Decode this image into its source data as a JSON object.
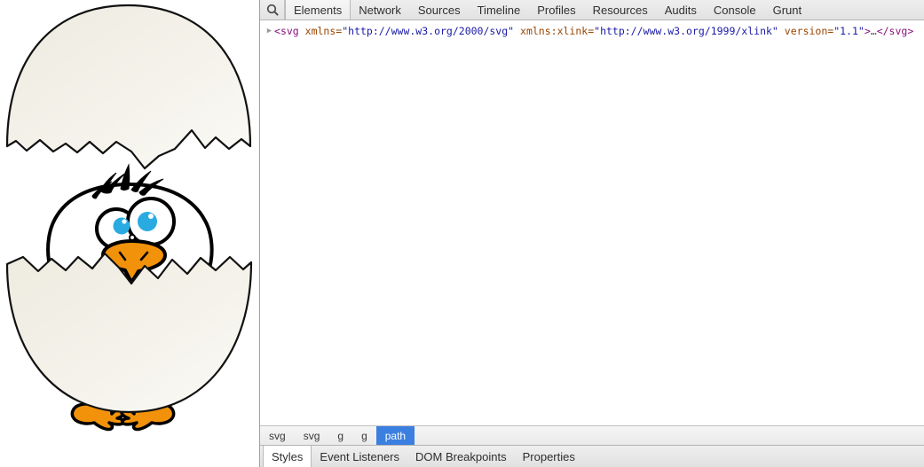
{
  "devtools": {
    "search_icon": "search-icon",
    "tabs": [
      {
        "label": "Elements",
        "active": true
      },
      {
        "label": "Network",
        "active": false
      },
      {
        "label": "Sources",
        "active": false
      },
      {
        "label": "Timeline",
        "active": false
      },
      {
        "label": "Profiles",
        "active": false
      },
      {
        "label": "Resources",
        "active": false
      },
      {
        "label": "Audits",
        "active": false
      },
      {
        "label": "Console",
        "active": false
      },
      {
        "label": "Grunt",
        "active": false
      }
    ],
    "dom": {
      "disclosure_glyph": "▶",
      "open_bracket": "<",
      "tag_name": "svg",
      "attributes": [
        {
          "name": "xmlns",
          "value": "\"http://www.w3.org/2000/svg\""
        },
        {
          "name": "xmlns:xlink",
          "value": "\"http://www.w3.org/1999/xlink\""
        },
        {
          "name": "version",
          "value": "\"1.1\""
        }
      ],
      "close_bracket": ">",
      "ellipsis": "…",
      "closing_tag": "</svg>"
    },
    "breadcrumb": [
      {
        "label": "svg",
        "selected": false
      },
      {
        "label": "svg",
        "selected": false
      },
      {
        "label": "g",
        "selected": false
      },
      {
        "label": "g",
        "selected": false
      },
      {
        "label": "path",
        "selected": true
      }
    ],
    "bottom_tabs": [
      {
        "label": "Styles",
        "active": true
      },
      {
        "label": "Event Listeners",
        "active": false
      },
      {
        "label": "DOM Breakpoints",
        "active": false
      },
      {
        "label": "Properties",
        "active": false
      }
    ],
    "selection_color": "#3b7fe0"
  },
  "page": {
    "artwork_name": "chick-hatching-from-egg",
    "colors": {
      "shell_fill": "#f3f1e8",
      "shell_stroke": "#000000",
      "body_fill": "#ffffff",
      "body_stroke": "#000000",
      "eye_white": "#ffffff",
      "iris": "#29abe2",
      "beak": "#f2920a",
      "feet": "#f2920a",
      "background": "#ffffff"
    }
  }
}
